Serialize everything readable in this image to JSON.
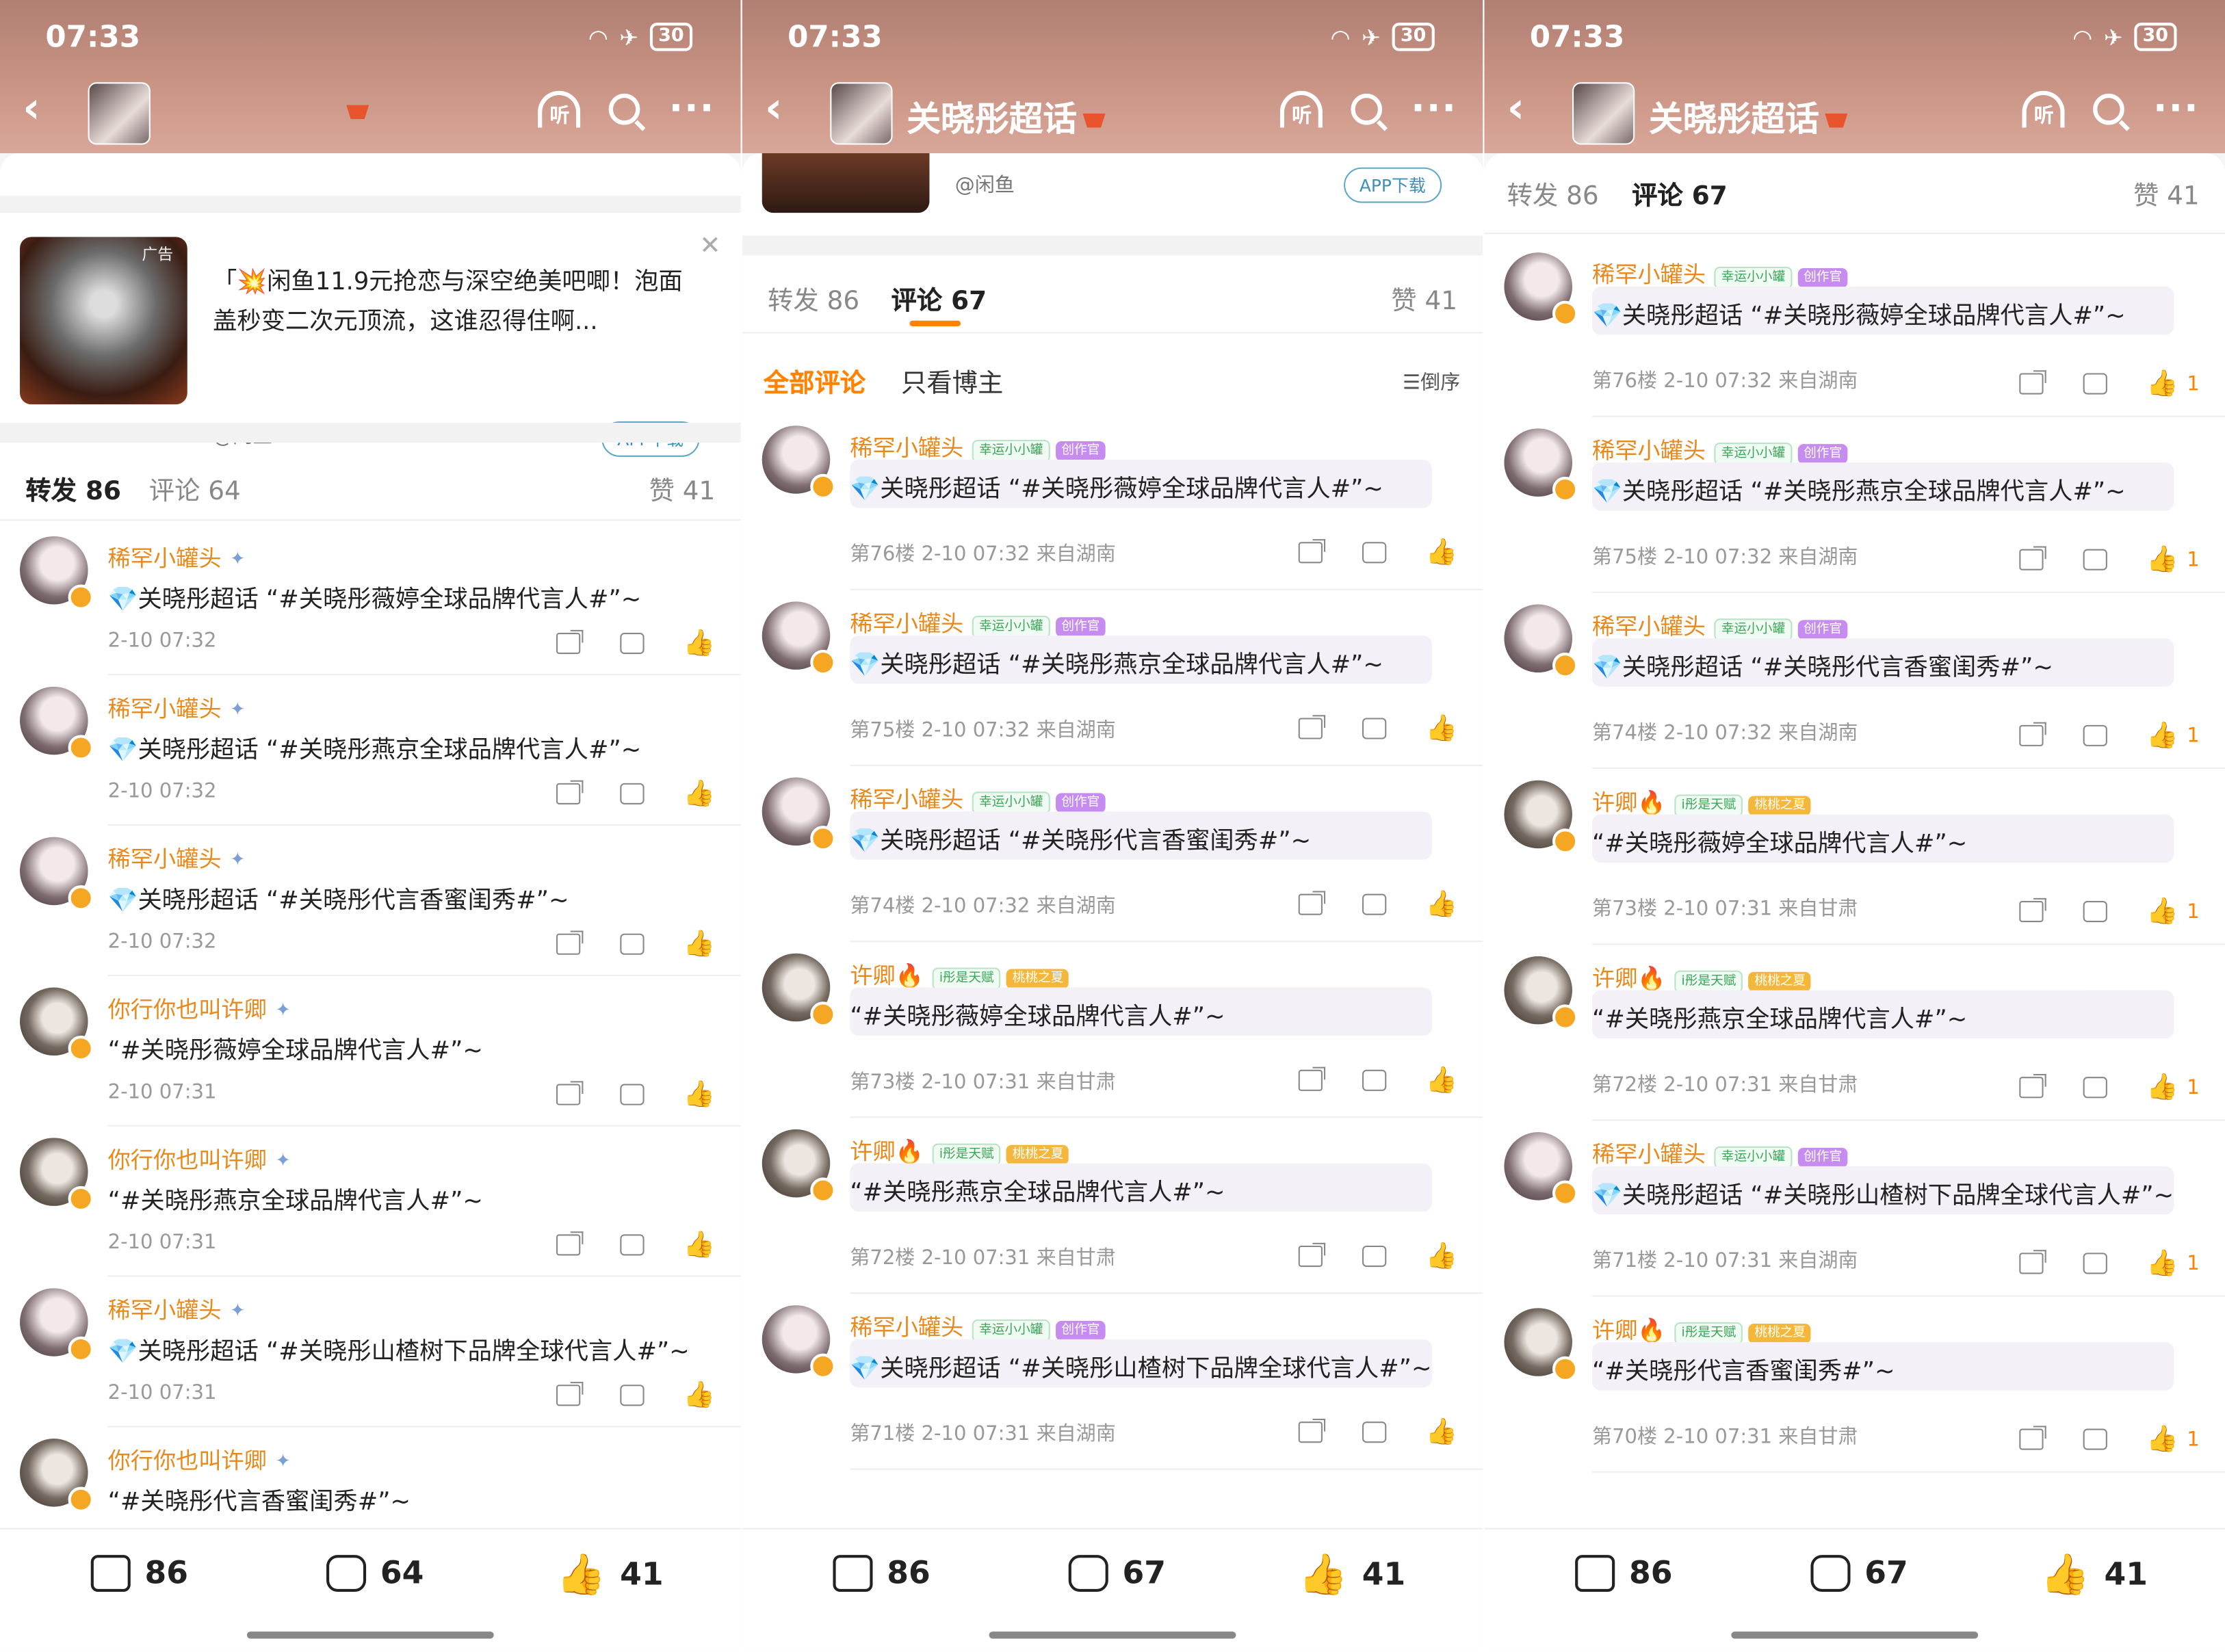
{
  "status_bar": {
    "time": "07:33",
    "battery": "30"
  },
  "header": {
    "topic_title": "关晓彤超话"
  },
  "ad": {
    "tag": "广告",
    "text": "「💥闲鱼11.9元抢恋与深空绝美吧唧！泡面盖秒变二次元顶流，这谁忍得住啊...",
    "source": "@闲鱼",
    "app_button": "APP下载"
  },
  "panels": [
    {
      "tabs": {
        "repost": "转发 86",
        "comment": "评论 64",
        "like": "赞 41",
        "active": "repost"
      },
      "items": [
        {
          "name": "稀罕小罐头",
          "text": "💎关晓彤超话 “#关晓彤薇婷全球品牌代言人#”~",
          "meta": "2-10 07:32"
        },
        {
          "name": "稀罕小罐头",
          "text": "💎关晓彤超话 “#关晓彤燕京全球品牌代言人#”~",
          "meta": "2-10 07:32"
        },
        {
          "name": "稀罕小罐头",
          "text": "💎关晓彤超话 “#关晓彤代言香蜜闺秀#”~",
          "meta": "2-10 07:32"
        },
        {
          "name": "你行你也叫许卿",
          "text": "“#关晓彤薇婷全球品牌代言人#”~",
          "meta": "2-10 07:31"
        },
        {
          "name": "你行你也叫许卿",
          "text": "“#关晓彤燕京全球品牌代言人#”~",
          "meta": "2-10 07:31"
        },
        {
          "name": "稀罕小罐头",
          "text": "💎关晓彤超话 “#关晓彤山楂树下品牌全球代言人#”~",
          "meta": "2-10 07:31"
        },
        {
          "name": "你行你也叫许卿",
          "text": "“#关晓彤代言香蜜闺秀#”~",
          "meta": ""
        }
      ],
      "footer": {
        "repost": "86",
        "comment": "64",
        "like": "41"
      }
    },
    {
      "tabs": {
        "repost": "转发 86",
        "comment": "评论 67",
        "like": "赞 41",
        "active": "comment"
      },
      "filter": {
        "all": "全部评论",
        "host": "只看博主",
        "sort": "倒序"
      },
      "items": [
        {
          "name": "稀罕小罐头",
          "badges": [
            "幸运小小罐",
            "创作官"
          ],
          "text": "💎关晓彤超话 “#关晓彤薇婷全球品牌代言人#”~",
          "meta": "第76楼 2-10 07:32 来自湖南"
        },
        {
          "name": "稀罕小罐头",
          "badges": [
            "幸运小小罐",
            "创作官"
          ],
          "text": "💎关晓彤超话 “#关晓彤燕京全球品牌代言人#”~",
          "meta": "第75楼 2-10 07:32 来自湖南"
        },
        {
          "name": "稀罕小罐头",
          "badges": [
            "幸运小小罐",
            "创作官"
          ],
          "text": "💎关晓彤超话 “#关晓彤代言香蜜闺秀#”~",
          "meta": "第74楼 2-10 07:32 来自湖南"
        },
        {
          "name": "许卿🔥",
          "badges": [
            "i彤是天赋",
            "桃桃之夏"
          ],
          "text": "“#关晓彤薇婷全球品牌代言人#”~",
          "meta": "第73楼 2-10 07:31 来自甘肃"
        },
        {
          "name": "许卿🔥",
          "badges": [
            "i彤是天赋",
            "桃桃之夏"
          ],
          "text": "“#关晓彤燕京全球品牌代言人#”~",
          "meta": "第72楼 2-10 07:31 来自甘肃"
        },
        {
          "name": "稀罕小罐头",
          "badges": [
            "幸运小小罐",
            "创作官"
          ],
          "text": "💎关晓彤超话 “#关晓彤山楂树下品牌全球代言人#”~",
          "meta": "第71楼 2-10 07:31 来自湖南"
        }
      ],
      "footer": {
        "repost": "86",
        "comment": "67",
        "like": "41"
      }
    },
    {
      "tabs": {
        "repost": "转发 86",
        "comment": "评论 67",
        "like": "赞 41",
        "active": "comment"
      },
      "items": [
        {
          "name": "稀罕小罐头",
          "badges": [
            "幸运小小罐",
            "创作官"
          ],
          "text": "💎关晓彤超话 “#关晓彤薇婷全球品牌代言人#”~",
          "meta": "第76楼 2-10 07:32 来自湖南",
          "likes": "1"
        },
        {
          "name": "稀罕小罐头",
          "badges": [
            "幸运小小罐",
            "创作官"
          ],
          "text": "💎关晓彤超话 “#关晓彤燕京全球品牌代言人#”~",
          "meta": "第75楼 2-10 07:32 来自湖南",
          "likes": "1"
        },
        {
          "name": "稀罕小罐头",
          "badges": [
            "幸运小小罐",
            "创作官"
          ],
          "text": "💎关晓彤超话 “#关晓彤代言香蜜闺秀#”~",
          "meta": "第74楼 2-10 07:32 来自湖南",
          "likes": "1"
        },
        {
          "name": "许卿🔥",
          "badges": [
            "i彤是天赋",
            "桃桃之夏"
          ],
          "text": "“#关晓彤薇婷全球品牌代言人#”~",
          "meta": "第73楼 2-10 07:31 来自甘肃",
          "likes": "1"
        },
        {
          "name": "许卿🔥",
          "badges": [
            "i彤是天赋",
            "桃桃之夏"
          ],
          "text": "“#关晓彤燕京全球品牌代言人#”~",
          "meta": "第72楼 2-10 07:31 来自甘肃",
          "likes": "1"
        },
        {
          "name": "稀罕小罐头",
          "badges": [
            "幸运小小罐",
            "创作官"
          ],
          "text": "💎关晓彤超话 “#关晓彤山楂树下品牌全球代言人#”~",
          "meta": "第71楼 2-10 07:31 来自湖南",
          "likes": "1"
        },
        {
          "name": "许卿🔥",
          "badges": [
            "i彤是天赋",
            "桃桃之夏"
          ],
          "text": "“#关晓彤代言香蜜闺秀#”~",
          "meta": "第70楼 2-10 07:31 来自甘肃",
          "likes": "1"
        }
      ],
      "footer": {
        "repost": "86",
        "comment": "67",
        "like": "41"
      }
    }
  ],
  "colors": {
    "accent": "#ff8200",
    "username": "#e8891c",
    "header_bg": "#c99484"
  }
}
